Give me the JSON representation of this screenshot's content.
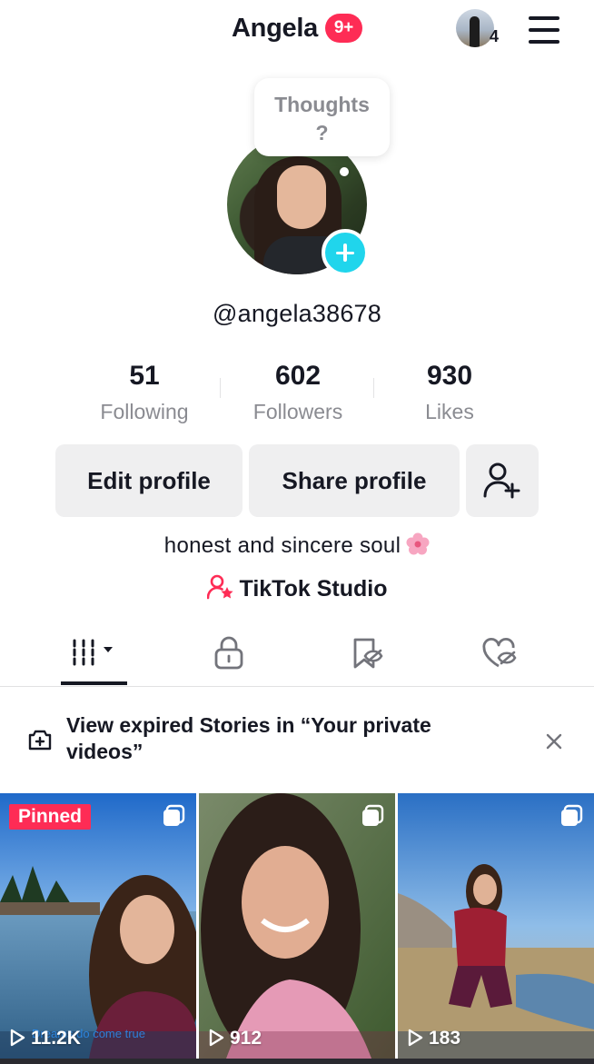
{
  "header": {
    "title": "Angela",
    "badge": "9+",
    "account_count": "4",
    "menu_icon": "hamburger-menu-icon"
  },
  "profile": {
    "bubble_text": "Thoughts\n?",
    "username": "@angela38678",
    "bio": "honest and sincere soul",
    "studio_label": "TikTok Studio"
  },
  "stats": [
    {
      "value": "51",
      "label": "Following"
    },
    {
      "value": "602",
      "label": "Followers"
    },
    {
      "value": "930",
      "label": "Likes"
    }
  ],
  "actions": {
    "edit_label": "Edit profile",
    "share_label": "Share profile",
    "add_friend_icon": "add-friend-icon"
  },
  "tabs": [
    {
      "icon": "grid-icon",
      "active": true
    },
    {
      "icon": "lock-icon",
      "active": false
    },
    {
      "icon": "favorites-icon",
      "active": false
    },
    {
      "icon": "liked-icon",
      "active": false
    }
  ],
  "banner": {
    "text": "View expired Stories in “Your private videos”",
    "icon": "story-icon",
    "close_icon": "close-icon"
  },
  "videos": [
    {
      "views": "11.2K",
      "pinned_label": "Pinned",
      "caption": "Dreams do come true"
    },
    {
      "views": "912"
    },
    {
      "views": "183"
    }
  ],
  "colors": {
    "accent": "#fe2c55",
    "cyan": "#20d5ec",
    "text": "#161823",
    "muted": "#8a8b91",
    "button_bg": "#efeff0"
  }
}
